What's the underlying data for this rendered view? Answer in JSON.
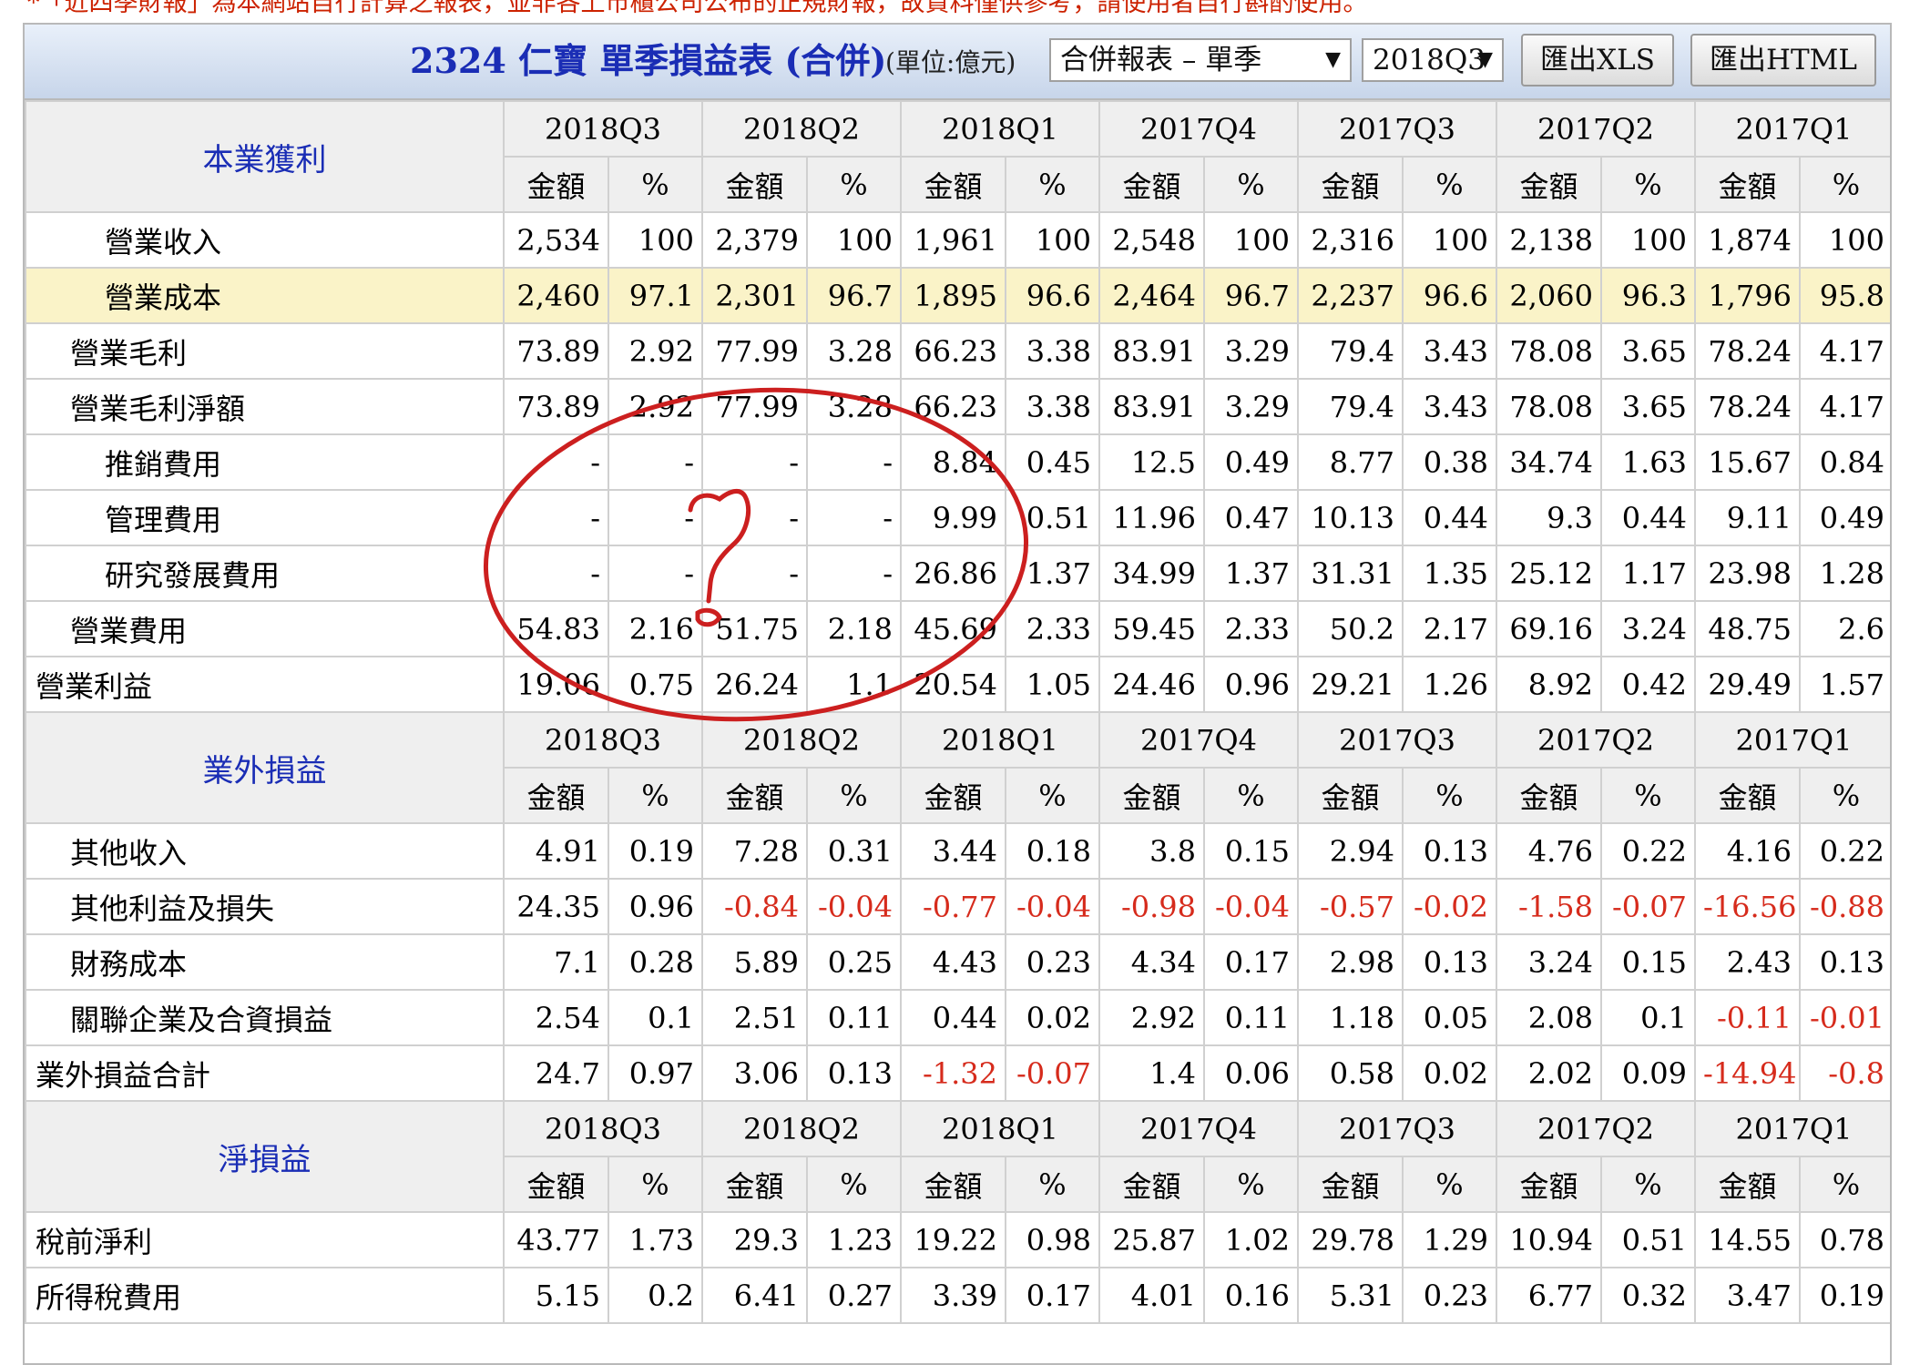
{
  "notice": "*「近四季財報」為本網站自行計算之報表，並非各上市櫃公司公布的正規財報，故資料僅供參考，請使用者自行斟酌使用。",
  "header": {
    "title": "2324 仁寶 單季損益表 (合併)",
    "unit": "(單位:億元)",
    "report_select": "合併報表 – 單季",
    "period_select": "2018Q3",
    "export_xls": "匯出XLS",
    "export_html": "匯出HTML"
  },
  "colors": {
    "title": "#1a2db5",
    "negative": "#d62b1c",
    "highlight_row": "#faf3c8",
    "annotation": "#cc1f1f"
  },
  "periods": [
    "2018Q3",
    "2018Q2",
    "2018Q1",
    "2017Q4",
    "2017Q3",
    "2017Q2",
    "2017Q1"
  ],
  "sub_headers": {
    "amount": "金額",
    "pct": "%"
  },
  "sections": [
    {
      "title": "本業獲利",
      "rows": [
        {
          "label": "營業收入",
          "indent": 3,
          "values": [
            "2,534",
            "100",
            "2,379",
            "100",
            "1,961",
            "100",
            "2,548",
            "100",
            "2,316",
            "100",
            "2,138",
            "100",
            "1,874",
            "100"
          ]
        },
        {
          "label": "營業成本",
          "indent": 3,
          "highlight": true,
          "values": [
            "2,460",
            "97.1",
            "2,301",
            "96.7",
            "1,895",
            "96.6",
            "2,464",
            "96.7",
            "2,237",
            "96.6",
            "2,060",
            "96.3",
            "1,796",
            "95.8"
          ]
        },
        {
          "label": "營業毛利",
          "indent": 2,
          "values": [
            "73.89",
            "2.92",
            "77.99",
            "3.28",
            "66.23",
            "3.38",
            "83.91",
            "3.29",
            "79.4",
            "3.43",
            "78.08",
            "3.65",
            "78.24",
            "4.17"
          ]
        },
        {
          "label": "營業毛利淨額",
          "indent": 2,
          "values": [
            "73.89",
            "2.92",
            "77.99",
            "3.28",
            "66.23",
            "3.38",
            "83.91",
            "3.29",
            "79.4",
            "3.43",
            "78.08",
            "3.65",
            "78.24",
            "4.17"
          ]
        },
        {
          "label": "推銷費用",
          "indent": 3,
          "values": [
            "-",
            "-",
            "-",
            "-",
            "8.84",
            "0.45",
            "12.5",
            "0.49",
            "8.77",
            "0.38",
            "34.74",
            "1.63",
            "15.67",
            "0.84"
          ]
        },
        {
          "label": "管理費用",
          "indent": 3,
          "values": [
            "-",
            "-",
            "-",
            "-",
            "9.99",
            "0.51",
            "11.96",
            "0.47",
            "10.13",
            "0.44",
            "9.3",
            "0.44",
            "9.11",
            "0.49"
          ]
        },
        {
          "label": "研究發展費用",
          "indent": 3,
          "values": [
            "-",
            "-",
            "-",
            "-",
            "26.86",
            "1.37",
            "34.99",
            "1.37",
            "31.31",
            "1.35",
            "25.12",
            "1.17",
            "23.98",
            "1.28"
          ]
        },
        {
          "label": "營業費用",
          "indent": 2,
          "values": [
            "54.83",
            "2.16",
            "51.75",
            "2.18",
            "45.69",
            "2.33",
            "59.45",
            "2.33",
            "50.2",
            "2.17",
            "69.16",
            "3.24",
            "48.75",
            "2.6"
          ]
        },
        {
          "label": "營業利益",
          "indent": 1,
          "values": [
            "19.06",
            "0.75",
            "26.24",
            "1.1",
            "20.54",
            "1.05",
            "24.46",
            "0.96",
            "29.21",
            "1.26",
            "8.92",
            "0.42",
            "29.49",
            "1.57"
          ]
        }
      ]
    },
    {
      "title": "業外損益",
      "rows": [
        {
          "label": "其他收入",
          "indent": 2,
          "values": [
            "4.91",
            "0.19",
            "7.28",
            "0.31",
            "3.44",
            "0.18",
            "3.8",
            "0.15",
            "2.94",
            "0.13",
            "4.76",
            "0.22",
            "4.16",
            "0.22"
          ]
        },
        {
          "label": "其他利益及損失",
          "indent": 2,
          "values": [
            "24.35",
            "0.96",
            "-0.84",
            "-0.04",
            "-0.77",
            "-0.04",
            "-0.98",
            "-0.04",
            "-0.57",
            "-0.02",
            "-1.58",
            "-0.07",
            "-16.56",
            "-0.88"
          ]
        },
        {
          "label": "財務成本",
          "indent": 2,
          "values": [
            "7.1",
            "0.28",
            "5.89",
            "0.25",
            "4.43",
            "0.23",
            "4.34",
            "0.17",
            "2.98",
            "0.13",
            "3.24",
            "0.15",
            "2.43",
            "0.13"
          ]
        },
        {
          "label": "關聯企業及合資損益",
          "indent": 2,
          "values": [
            "2.54",
            "0.1",
            "2.51",
            "0.11",
            "0.44",
            "0.02",
            "2.92",
            "0.11",
            "1.18",
            "0.05",
            "2.08",
            "0.1",
            "-0.11",
            "-0.01"
          ]
        },
        {
          "label": "業外損益合計",
          "indent": 1,
          "values": [
            "24.7",
            "0.97",
            "3.06",
            "0.13",
            "-1.32",
            "-0.07",
            "1.4",
            "0.06",
            "0.58",
            "0.02",
            "2.02",
            "0.09",
            "-14.94",
            "-0.8"
          ]
        }
      ]
    },
    {
      "title": "淨損益",
      "rows": [
        {
          "label": "稅前淨利",
          "indent": 1,
          "values": [
            "43.77",
            "1.73",
            "29.3",
            "1.23",
            "19.22",
            "0.98",
            "25.87",
            "1.02",
            "29.78",
            "1.29",
            "10.94",
            "0.51",
            "14.55",
            "0.78"
          ]
        },
        {
          "label": "所得稅費用",
          "indent": 1,
          "values": [
            "5.15",
            "0.2",
            "6.41",
            "0.27",
            "3.39",
            "0.17",
            "4.01",
            "0.16",
            "5.31",
            "0.23",
            "6.77",
            "0.32",
            "3.47",
            "0.19"
          ]
        }
      ]
    }
  ]
}
